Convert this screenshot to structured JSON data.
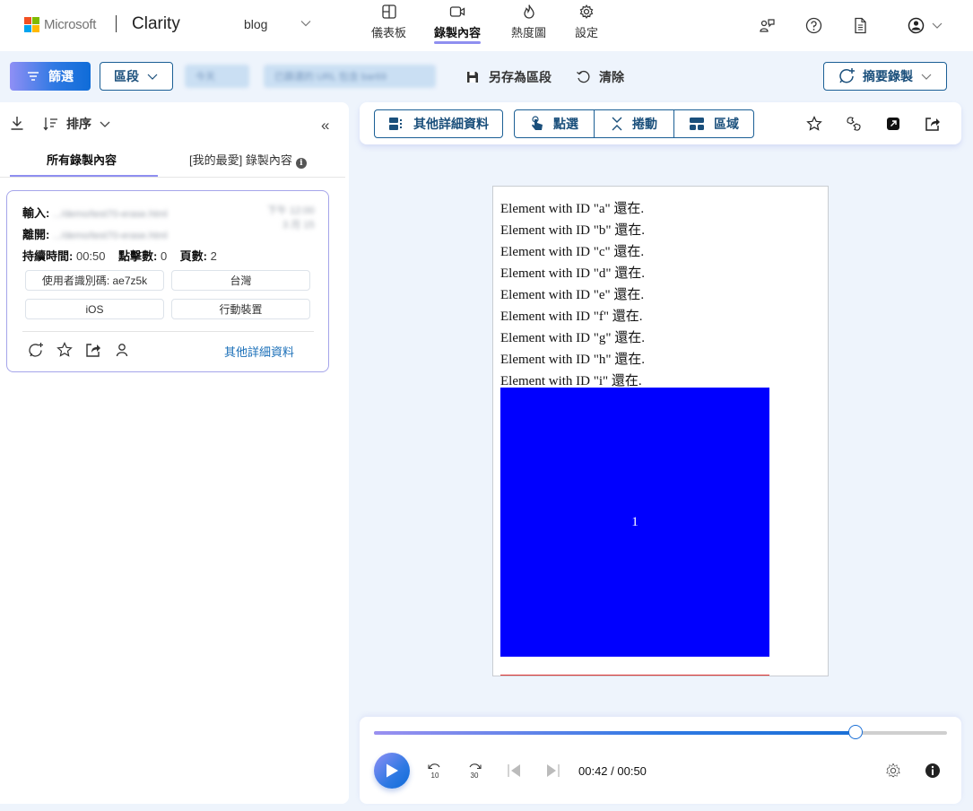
{
  "header": {
    "brand": "Microsoft",
    "product": "Clarity",
    "project": "blog",
    "nav": [
      {
        "label": "儀表板",
        "icon": "dashboard-icon",
        "active": false
      },
      {
        "label": "錄製內容",
        "icon": "video-camera-icon",
        "active": true
      },
      {
        "label": "熱度圖",
        "icon": "flame-icon",
        "active": false
      },
      {
        "label": "設定",
        "icon": "gear-icon",
        "active": false
      }
    ],
    "right_icons": [
      "share-users-icon",
      "help-icon",
      "document-icon",
      "account-icon"
    ]
  },
  "filter_bar": {
    "filter_label": "篩選",
    "segment_label": "區段",
    "chips": [
      "今天",
      "已篩選的 URL 包含 bar69"
    ],
    "save_segment_label": "另存為區段",
    "clear_label": "清除",
    "summary_label": "摘要錄製"
  },
  "left_panel": {
    "sort_label": "排序",
    "tabs": [
      {
        "label": "所有錄製內容",
        "active": true
      },
      {
        "label": "[我的最愛] 錄製內容",
        "active": false
      }
    ],
    "recording": {
      "entry_label": "輸入:",
      "entry_value": ".../demo/test70-erase.html",
      "exit_label": "離開:",
      "exit_value": ".../demo/test70-erase.html",
      "time_blurred": "下午 12:00",
      "date_blurred": "3 月 15",
      "duration_label": "持續時間:",
      "duration_value": "00:50",
      "clicks_label": "點擊數:",
      "clicks_value": "0",
      "pages_label": "頁數:",
      "pages_value": "2",
      "tags": [
        "使用者識別碼: ae7z5k",
        "台灣",
        "iOS",
        "行動裝置"
      ],
      "more_details_label": "其他詳細資料"
    }
  },
  "toolbar": {
    "more_details_label": "其他詳細資料",
    "click_label": "點選",
    "scroll_label": "捲動",
    "area_label": "區域"
  },
  "viewer": {
    "lines": [
      "Element with ID \"a\" 還在.",
      "Element with ID \"b\" 還在.",
      "Element with ID \"c\" 還在.",
      "Element with ID \"d\" 還在.",
      "Element with ID \"e\" 還在.",
      "Element with ID \"f\" 還在.",
      "Element with ID \"g\" 還在.",
      "Element with ID \"h\" 還在.",
      "Element with ID \"i\" 還在."
    ],
    "box_label": "1",
    "box_color": "#0000ff",
    "line_color": "#dd3333"
  },
  "player": {
    "current_time": "00:42",
    "total_time": "00:50",
    "time_display": "00:42 / 00:50",
    "progress_fraction": 0.84,
    "rewind_seconds": "10",
    "forward_seconds": "30"
  },
  "colors": {
    "accent": "#1a4f7b",
    "brand_gradient_start": "#8f8ff5",
    "brand_gradient_end": "#0f6cd8",
    "active_underline": "#8f8ff0",
    "link": "#1a6fb8"
  }
}
